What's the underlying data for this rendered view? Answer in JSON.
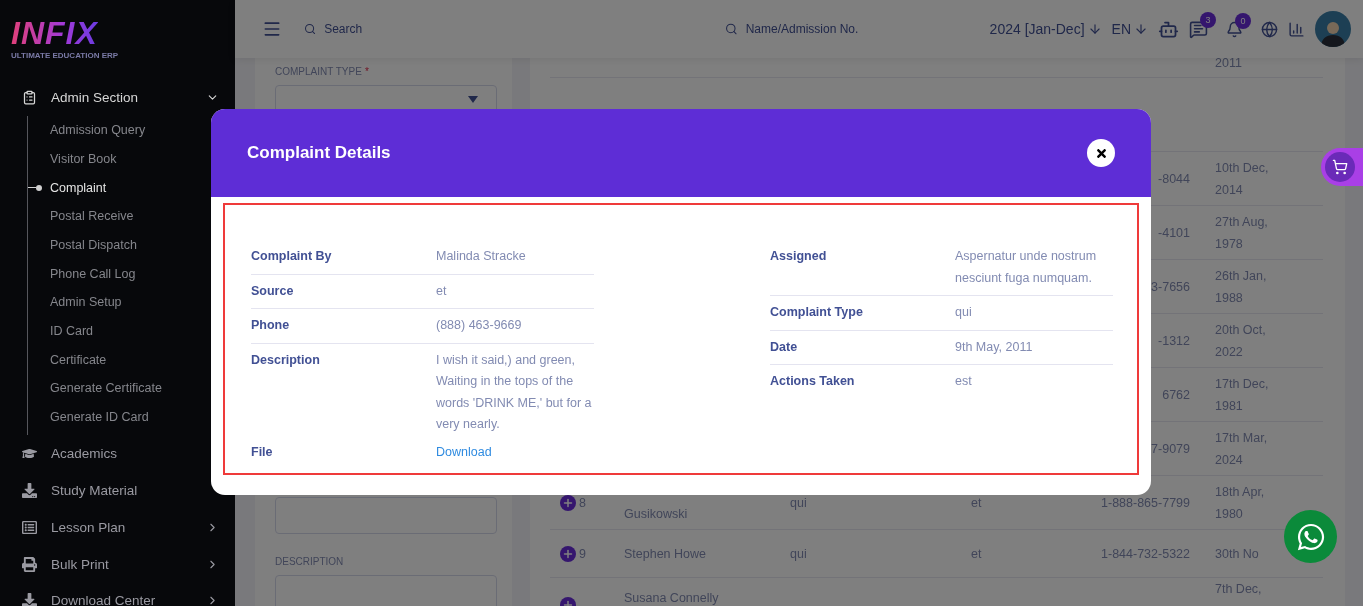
{
  "sidebar": {
    "logo": {
      "word": "INFIX",
      "tagline": "ULTIMATE EDUCATION ERP"
    },
    "sections": [
      {
        "label": "Admin Section",
        "expanded": true,
        "arrow": true,
        "children": [
          {
            "label": "Admission Query",
            "selected": false
          },
          {
            "label": "Visitor Book",
            "selected": false
          },
          {
            "label": "Complaint",
            "selected": true
          },
          {
            "label": "Postal Receive",
            "selected": false
          },
          {
            "label": "Postal Dispatch",
            "selected": false
          },
          {
            "label": "Phone Call Log",
            "selected": false
          },
          {
            "label": "Admin Setup",
            "selected": false
          },
          {
            "label": "ID Card",
            "selected": false
          },
          {
            "label": "Certificate",
            "selected": false
          },
          {
            "label": "Generate Certificate",
            "selected": false
          },
          {
            "label": "Generate ID Card",
            "selected": false
          }
        ]
      },
      {
        "label": "Academics",
        "expanded": false,
        "arrow": false
      },
      {
        "label": "Study Material",
        "expanded": false,
        "arrow": false
      },
      {
        "label": "Lesson Plan",
        "expanded": false,
        "arrow": true
      },
      {
        "label": "Bulk Print",
        "expanded": false,
        "arrow": true
      },
      {
        "label": "Download Center",
        "expanded": false,
        "arrow": true
      }
    ]
  },
  "topbar": {
    "search": {
      "placeholder": "Search"
    },
    "student_search": {
      "placeholder": "Name/Admission No."
    },
    "session": "2024 [Jan-Dec]",
    "language": "EN",
    "messages_count": "3",
    "notifications_count": "0"
  },
  "form": {
    "fields": [
      {
        "kind": "select",
        "label": "COMPLAINT TYPE",
        "required_mark": "*"
      },
      {
        "kind": "textarea"
      },
      {
        "kind": "textarea",
        "label": "DESCRIPTION"
      }
    ]
  },
  "table": {
    "rows": [
      {
        "date": "2011"
      },
      {
        "kind": "header"
      },
      {
        "phone": "-8044",
        "date": "10th Dec, 2014"
      },
      {
        "phone": "-4101",
        "date": "27th Aug, 1978"
      },
      {
        "phone": "3-7656",
        "date": "26th Jan, 1988"
      },
      {
        "phone": "-1312",
        "date": "20th Oct, 2022"
      },
      {
        "phone": "6762",
        "date": "17th Dec, 1981"
      },
      {
        "phone": "7-9079",
        "date": "17th Mar, 2024"
      },
      {
        "expand": true,
        "number": "8",
        "name": "Gusikowski",
        "column_3": "qui",
        "column_4": "et",
        "phone": "1-888-865-7799",
        "date": "18th Apr, 1980"
      },
      {
        "expand": true,
        "number": "9",
        "name": "Stephen Howe",
        "column_3": "qui",
        "column_4": "et",
        "phone": "1-844-732-5322",
        "date": "30th No"
      },
      {
        "kind": "last",
        "expand": true,
        "name": "Susana Connelly",
        "date": "7th Dec,"
      }
    ]
  },
  "modal": {
    "title": "Complaint Details",
    "left": [
      {
        "label": "Complaint By",
        "value": "Malinda Stracke",
        "rule_below": true
      },
      {
        "label": "Source",
        "value": "et",
        "rule_below": true
      },
      {
        "label": "Phone",
        "value": "(888) 463-9669",
        "rule_below": true
      },
      {
        "label": "Description",
        "value": "I wish it said,) and green, Waiting in the tops of the words 'DRINK ME,' but for a very nearly.",
        "rule_below": false
      },
      {
        "label": "File",
        "value": "Download",
        "kind": "link",
        "rule_below": false
      }
    ],
    "right": [
      {
        "label": "Assigned",
        "value": "Aspernatur unde nostrum nesciunt fuga numquam.",
        "rule_below": true
      },
      {
        "label": "Complaint Type",
        "value": "qui",
        "rule_below": true
      },
      {
        "label": "Date",
        "value": "9th May, 2011",
        "rule_below": true
      },
      {
        "label": "Actions Taken",
        "value": "est",
        "rule_below": false
      }
    ]
  }
}
